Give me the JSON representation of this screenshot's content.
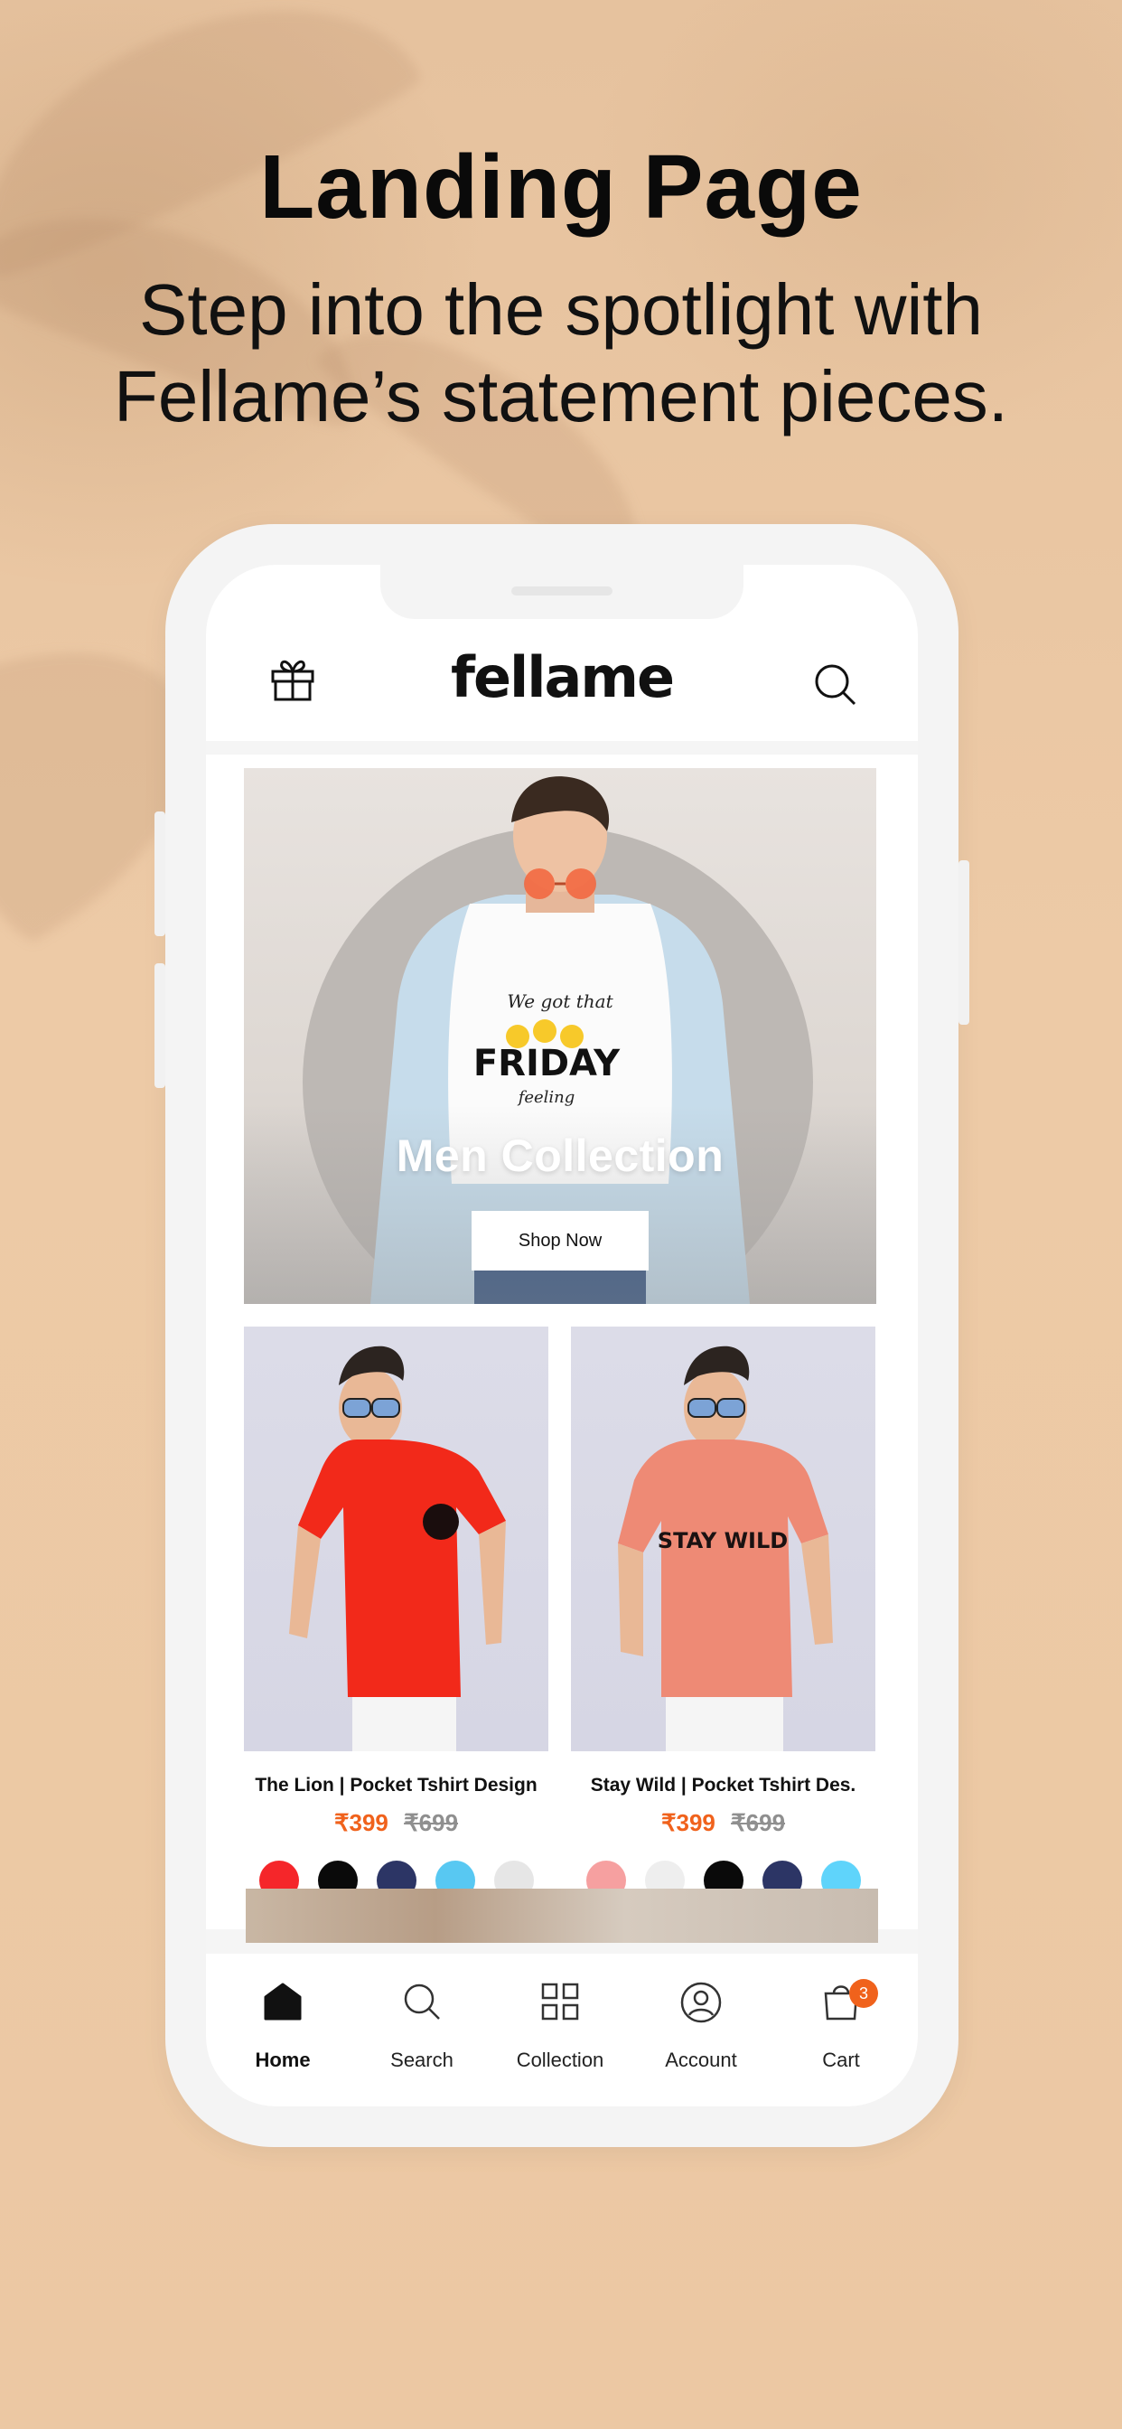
{
  "promo": {
    "title": "Landing Page",
    "subtitle_line1": "Step into the spotlight with",
    "subtitle_line2": "Fellame’s statement pieces."
  },
  "app": {
    "logo": "fellame",
    "gift_icon": "gift-icon",
    "search_icon": "search-icon"
  },
  "hero": {
    "tshirt_text_top": "We got that",
    "tshirt_text_main": "FRIDAY",
    "tshirt_text_bottom": "feeling",
    "title": "Men Collection",
    "button": "Shop Now"
  },
  "products": [
    {
      "name": "The Lion | Pocket Tshirt Design",
      "price": "₹399",
      "old_price": "₹699",
      "shirt_color": "#f2291a",
      "swatches": [
        "#f5262a",
        "#0a0a0a",
        "#2c3565",
        "#58c8f2",
        "#e6e6e6"
      ]
    },
    {
      "name": "Stay Wild | Pocket Tshirt Des.",
      "price": "₹399",
      "old_price": "₹699",
      "shirt_color": "#ee8a75",
      "shirt_print": "STAY WILD",
      "swatches": [
        "#f6a0a0",
        "#eeeeee",
        "#0a0a0a",
        "#2c3565",
        "#5fd4fb"
      ]
    }
  ],
  "tabbar": {
    "items": [
      {
        "label": "Home",
        "icon": "home-icon",
        "active": true
      },
      {
        "label": "Search",
        "icon": "search-icon"
      },
      {
        "label": "Collection",
        "icon": "grid-icon"
      },
      {
        "label": "Account",
        "icon": "account-icon"
      },
      {
        "label": "Cart",
        "icon": "cart-icon",
        "badge": "3"
      }
    ]
  },
  "colors": {
    "accent": "#f0621c",
    "background": "#e8c39f"
  }
}
